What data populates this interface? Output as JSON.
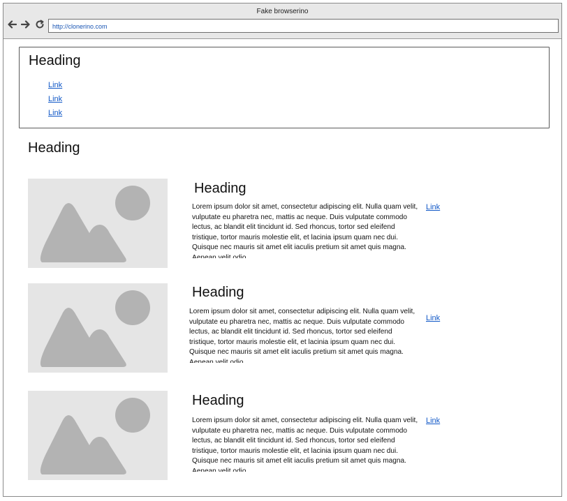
{
  "window": {
    "title": "Fake browserino"
  },
  "toolbar": {
    "back_icon": "arrow-left-icon",
    "forward_icon": "arrow-right-icon",
    "reload_icon": "reload-icon",
    "address": "http://clonerino.com"
  },
  "top_box": {
    "heading": "Heading",
    "links": [
      "Link",
      "Link",
      "Link"
    ]
  },
  "section": {
    "heading": "Heading"
  },
  "cards": [
    {
      "image_icon": "image-placeholder-icon",
      "heading": "Heading",
      "text": "Lorem ipsum dolor sit amet, consectetur adipiscing elit. Nulla quam velit, vulputate eu pharetra nec, mattis ac neque. Duis vulputate commodo lectus, ac blandit elit tincidunt id. Sed rhoncus, tortor sed eleifend tristique, tortor mauris molestie elit, et lacinia ipsum quam nec dui. Quisque nec mauris sit amet elit iaculis pretium sit amet quis magna. Aenean velit odio",
      "link": "Link"
    },
    {
      "image_icon": "image-placeholder-icon",
      "heading": "Heading",
      "text": "Lorem ipsum dolor sit amet, consectetur adipiscing elit. Nulla quam velit, vulputate eu pharetra nec, mattis ac neque. Duis vulputate commodo lectus, ac blandit elit tincidunt id. Sed rhoncus, tortor sed eleifend tristique, tortor mauris molestie elit, et lacinia ipsum quam nec dui. Quisque nec mauris sit amet elit iaculis pretium sit amet quis magna. Aenean velit odio",
      "link": "Link"
    },
    {
      "image_icon": "image-placeholder-icon",
      "heading": "Heading",
      "text": "Lorem ipsum dolor sit amet, consectetur adipiscing elit. Nulla quam velit, vulputate eu pharetra nec, mattis ac neque. Duis vulputate commodo lectus, ac blandit elit tincidunt id. Sed rhoncus, tortor sed eleifend tristique, tortor mauris molestie elit, et lacinia ipsum quam nec dui. Quisque nec mauris sit amet elit iaculis pretium sit amet quis magna. Aenean velit odio",
      "link": "Link"
    }
  ]
}
